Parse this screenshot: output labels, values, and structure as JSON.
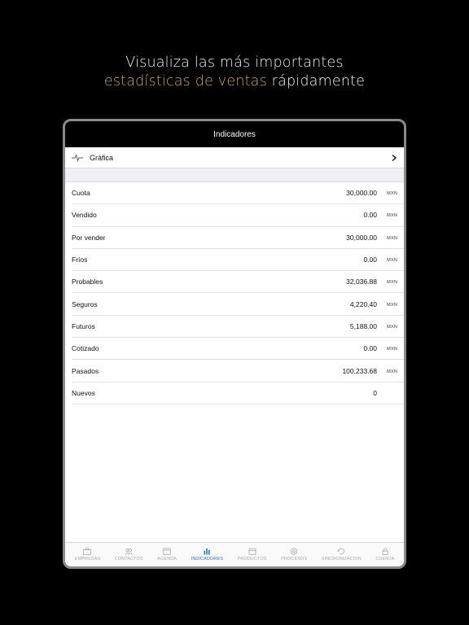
{
  "promo": {
    "line1": "Visualiza las más importantes",
    "line2_accent": "estadísticas de ventas",
    "line2_rest": " rápidamente"
  },
  "navbar": {
    "title": "Indicadores"
  },
  "graph": {
    "label": "Gráfica",
    "icon": "pulse-icon"
  },
  "indicators": [
    {
      "name": "Cuota",
      "value": "30,000.00",
      "currency": "MXN"
    },
    {
      "name": "Vendido",
      "value": "0.00",
      "currency": "MXN"
    },
    {
      "name": "Por vender",
      "value": "30,000.00",
      "currency": "MXN"
    },
    {
      "name": "Fríos",
      "value": "0.00",
      "currency": "MXN"
    },
    {
      "name": "Probables",
      "value": "32,036.88",
      "currency": "MXN"
    },
    {
      "name": "Seguros",
      "value": "4,220.40",
      "currency": "MXN"
    },
    {
      "name": "Futuros",
      "value": "5,188.00",
      "currency": "MXN"
    },
    {
      "name": "Cotizado",
      "value": "0.00",
      "currency": "MXN"
    },
    {
      "name": "Pasados",
      "value": "100,233.68",
      "currency": "MXN"
    },
    {
      "name": "Nuevos",
      "value": "0",
      "currency": ""
    }
  ],
  "tabs": [
    {
      "label": "EMPRESAS",
      "icon": "briefcase-icon"
    },
    {
      "label": "CONTACTOS",
      "icon": "people-icon"
    },
    {
      "label": "AGENDA",
      "icon": "calendar-icon"
    },
    {
      "label": "INDICADORES",
      "icon": "bar-chart-icon",
      "active": true
    },
    {
      "label": "PRODUCTOS",
      "icon": "box-icon"
    },
    {
      "label": "PROCESOS",
      "icon": "gear-icon"
    },
    {
      "label": "SINCRONIZACION",
      "icon": "sync-icon"
    },
    {
      "label": "CUENTA",
      "icon": "lock-icon"
    }
  ],
  "colors": {
    "accent_text": "#c9a27e",
    "tab_active": "#2b6fd1",
    "background": "#000000"
  }
}
